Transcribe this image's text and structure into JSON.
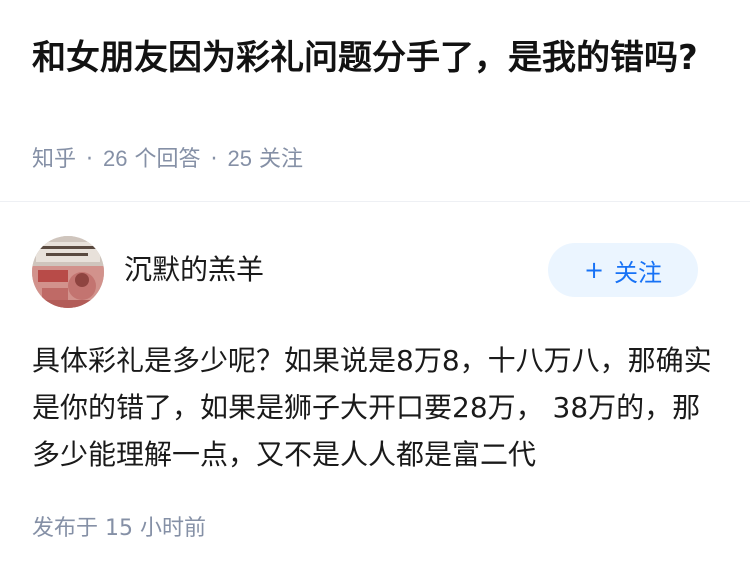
{
  "question": {
    "title": "和女朋友因为彩礼问题分手了，是我的错吗?",
    "source": "知乎",
    "answer_count": "26",
    "answer_unit": "个回答",
    "follower_count": "25",
    "follower_unit": "关注",
    "separator": "·"
  },
  "answer": {
    "author": {
      "name": "沉默的羔羊",
      "avatar_icon": "avatar-banknote-image"
    },
    "follow_button": {
      "icon": "plus-icon",
      "label": "关注"
    },
    "content": "具体彩礼是多少呢？如果说是8万8，十八万八，那确实是你的错了，如果是狮子大开口要28万， 38万的，那多少能理解一点，又不是人人都是富二代",
    "published_prefix": "发布于",
    "published_time": "15 小时前"
  },
  "colors": {
    "title": "#121212",
    "meta": "#8590a6",
    "button_bg": "#ebf5ff",
    "button_text": "#1772f6",
    "divider": "#eef0f4"
  }
}
